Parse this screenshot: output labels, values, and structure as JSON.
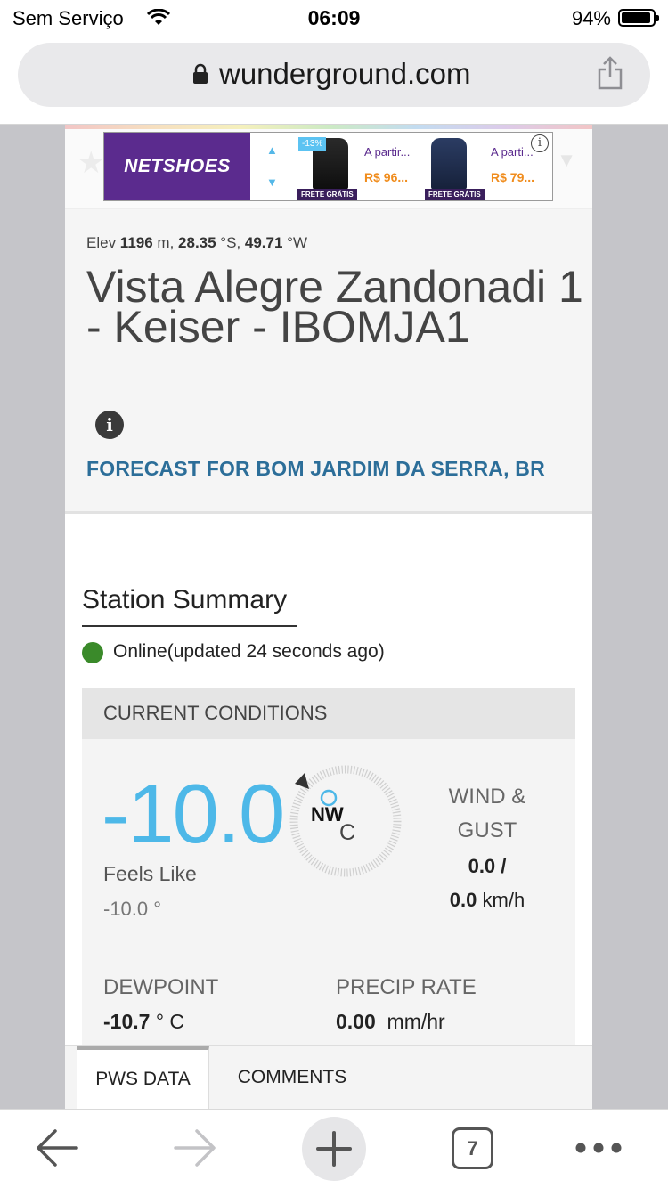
{
  "status_bar": {
    "carrier": "Sem Serviço",
    "time": "06:09",
    "battery": "94%"
  },
  "browser": {
    "url": "wunderground.com",
    "tab_count": "7"
  },
  "ad": {
    "brand": "NETSHOES",
    "discount": "-13%",
    "item1_from": "A partir...",
    "item1_price": "R$ 96...",
    "item2_from": "A parti...",
    "item2_price": "R$ 79...",
    "free_shipping": "FRETE GRÁTIS",
    "info": "i"
  },
  "station": {
    "elev_prefix": "Elev ",
    "elev_value": "1196",
    "elev_mid": " m, ",
    "lat_value": "28.35",
    "lat_unit": " °S, ",
    "lon_value": "49.71",
    "lon_unit": " °W",
    "name": "Vista Alegre Zandonadi 1 - Keiser - IBOMJA1",
    "info": "i",
    "forecast_link": "FORECAST FOR BOM JARDIM DA SERRA, BR"
  },
  "summary": {
    "title": "Station Summary",
    "online_status": "Online(updated 24 seconds ago)",
    "conditions_header": "CURRENT CONDITIONS",
    "temperature": "-10.0",
    "temp_unit": "C",
    "wind_direction": "NW",
    "feels_like_label": "Feels Like",
    "feels_like_value": "-10.0 °",
    "wind_label_1": "WIND &",
    "wind_label_2": "GUST",
    "wind_speed": "0.0",
    "wind_sep": " /",
    "gust_speed": "0.0",
    "wind_unit": " km/h",
    "dewpoint_label": "DEWPOINT",
    "dewpoint_value": "-10.7",
    "dewpoint_unit": " ° C",
    "precip_label": "PRECIP RATE",
    "precip_value": "0.00",
    "precip_unit": "  mm/hr"
  },
  "tabs": [
    {
      "label": "PWS DATA",
      "active": true
    },
    {
      "label": "COMMENTS",
      "active": false
    }
  ],
  "colors": {
    "temperature": "#4db8e8",
    "forecast_link": "#2c6e99",
    "online": "#3a8a2a",
    "ad_brand": "#5b2b8e"
  }
}
